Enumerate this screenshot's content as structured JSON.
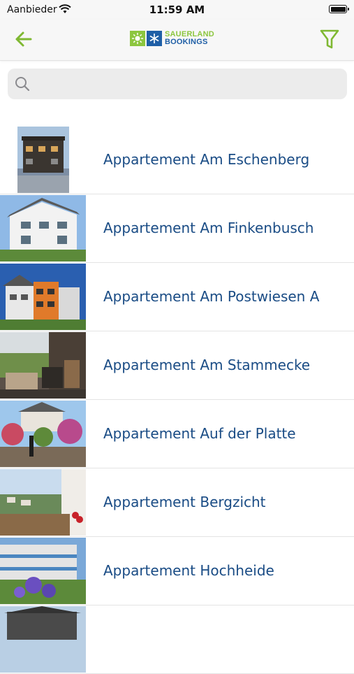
{
  "status_bar": {
    "carrier": "Aanbieder",
    "time": "11:59 AM"
  },
  "nav": {
    "logo_line1": "SAUERLAND",
    "logo_line2": "BOOKINGS",
    "accent_color": "#7fb832",
    "brand_blue": "#1f5fa6"
  },
  "search": {
    "placeholder": "",
    "value": ""
  },
  "listings": [
    {
      "name": "Appartement Am Eschenberg"
    },
    {
      "name": "Appartement Am Finkenbusch"
    },
    {
      "name": "Appartement Am Postwiesen A"
    },
    {
      "name": "Appartement Am Stammecke"
    },
    {
      "name": "Appartement Auf der Platte"
    },
    {
      "name": "Appartement Bergzicht"
    },
    {
      "name": "Appartement Hochheide"
    },
    {
      "name": ""
    }
  ]
}
